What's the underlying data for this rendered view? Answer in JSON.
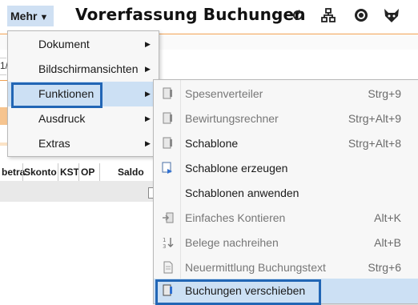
{
  "header": {
    "menu_button": "Mehr",
    "title": "Vorerfassung Buchungen",
    "icons": [
      "refresh-icon",
      "network-icon",
      "help-icon",
      "helper-mascot-icon"
    ]
  },
  "background": {
    "field_value": "1/",
    "table_columns": [
      "betra",
      "Skonto",
      "KST",
      "OP",
      "Saldo"
    ]
  },
  "menu": {
    "items": [
      {
        "label": "Dokument"
      },
      {
        "label": "Bildschirmansichten"
      },
      {
        "label": "Funktionen"
      },
      {
        "label": "Ausdruck"
      },
      {
        "label": "Extras"
      }
    ],
    "active_index": 2
  },
  "submenu": {
    "items": [
      {
        "label": "Spesenverteiler",
        "shortcut": "Strg+9",
        "icon": "document-pin-icon",
        "enabled": false
      },
      {
        "label": "Bewirtungsrechner",
        "shortcut": "Strg+Alt+9",
        "icon": "document-pin-icon",
        "enabled": false
      },
      {
        "label": "Schablone",
        "shortcut": "Strg+Alt+8",
        "icon": "document-pin-icon",
        "enabled": true
      },
      {
        "label": "Schablone erzeugen",
        "shortcut": "",
        "icon": "template-create-icon",
        "enabled": true
      },
      {
        "label": "Schablonen anwenden",
        "shortcut": "",
        "icon": "",
        "enabled": true
      },
      {
        "label": "Einfaches Kontieren",
        "shortcut": "Alt+K",
        "icon": "arrow-in-icon",
        "enabled": false
      },
      {
        "label": "Belege nachreihen",
        "shortcut": "Alt+B",
        "icon": "sort-numbers-icon",
        "enabled": false
      },
      {
        "label": "Neuermittlung Buchungstext",
        "shortcut": "Strg+6",
        "icon": "document-icon",
        "enabled": false
      },
      {
        "label": "Buchungen verschieben",
        "shortcut": "",
        "icon": "document-move-icon",
        "enabled": true
      }
    ],
    "active_index": 8
  },
  "colors": {
    "highlight": "#cce0f4",
    "focus_border": "#2266b5",
    "menu_bg": "#f7f7f7",
    "accent_orange": "#f6c48f"
  }
}
